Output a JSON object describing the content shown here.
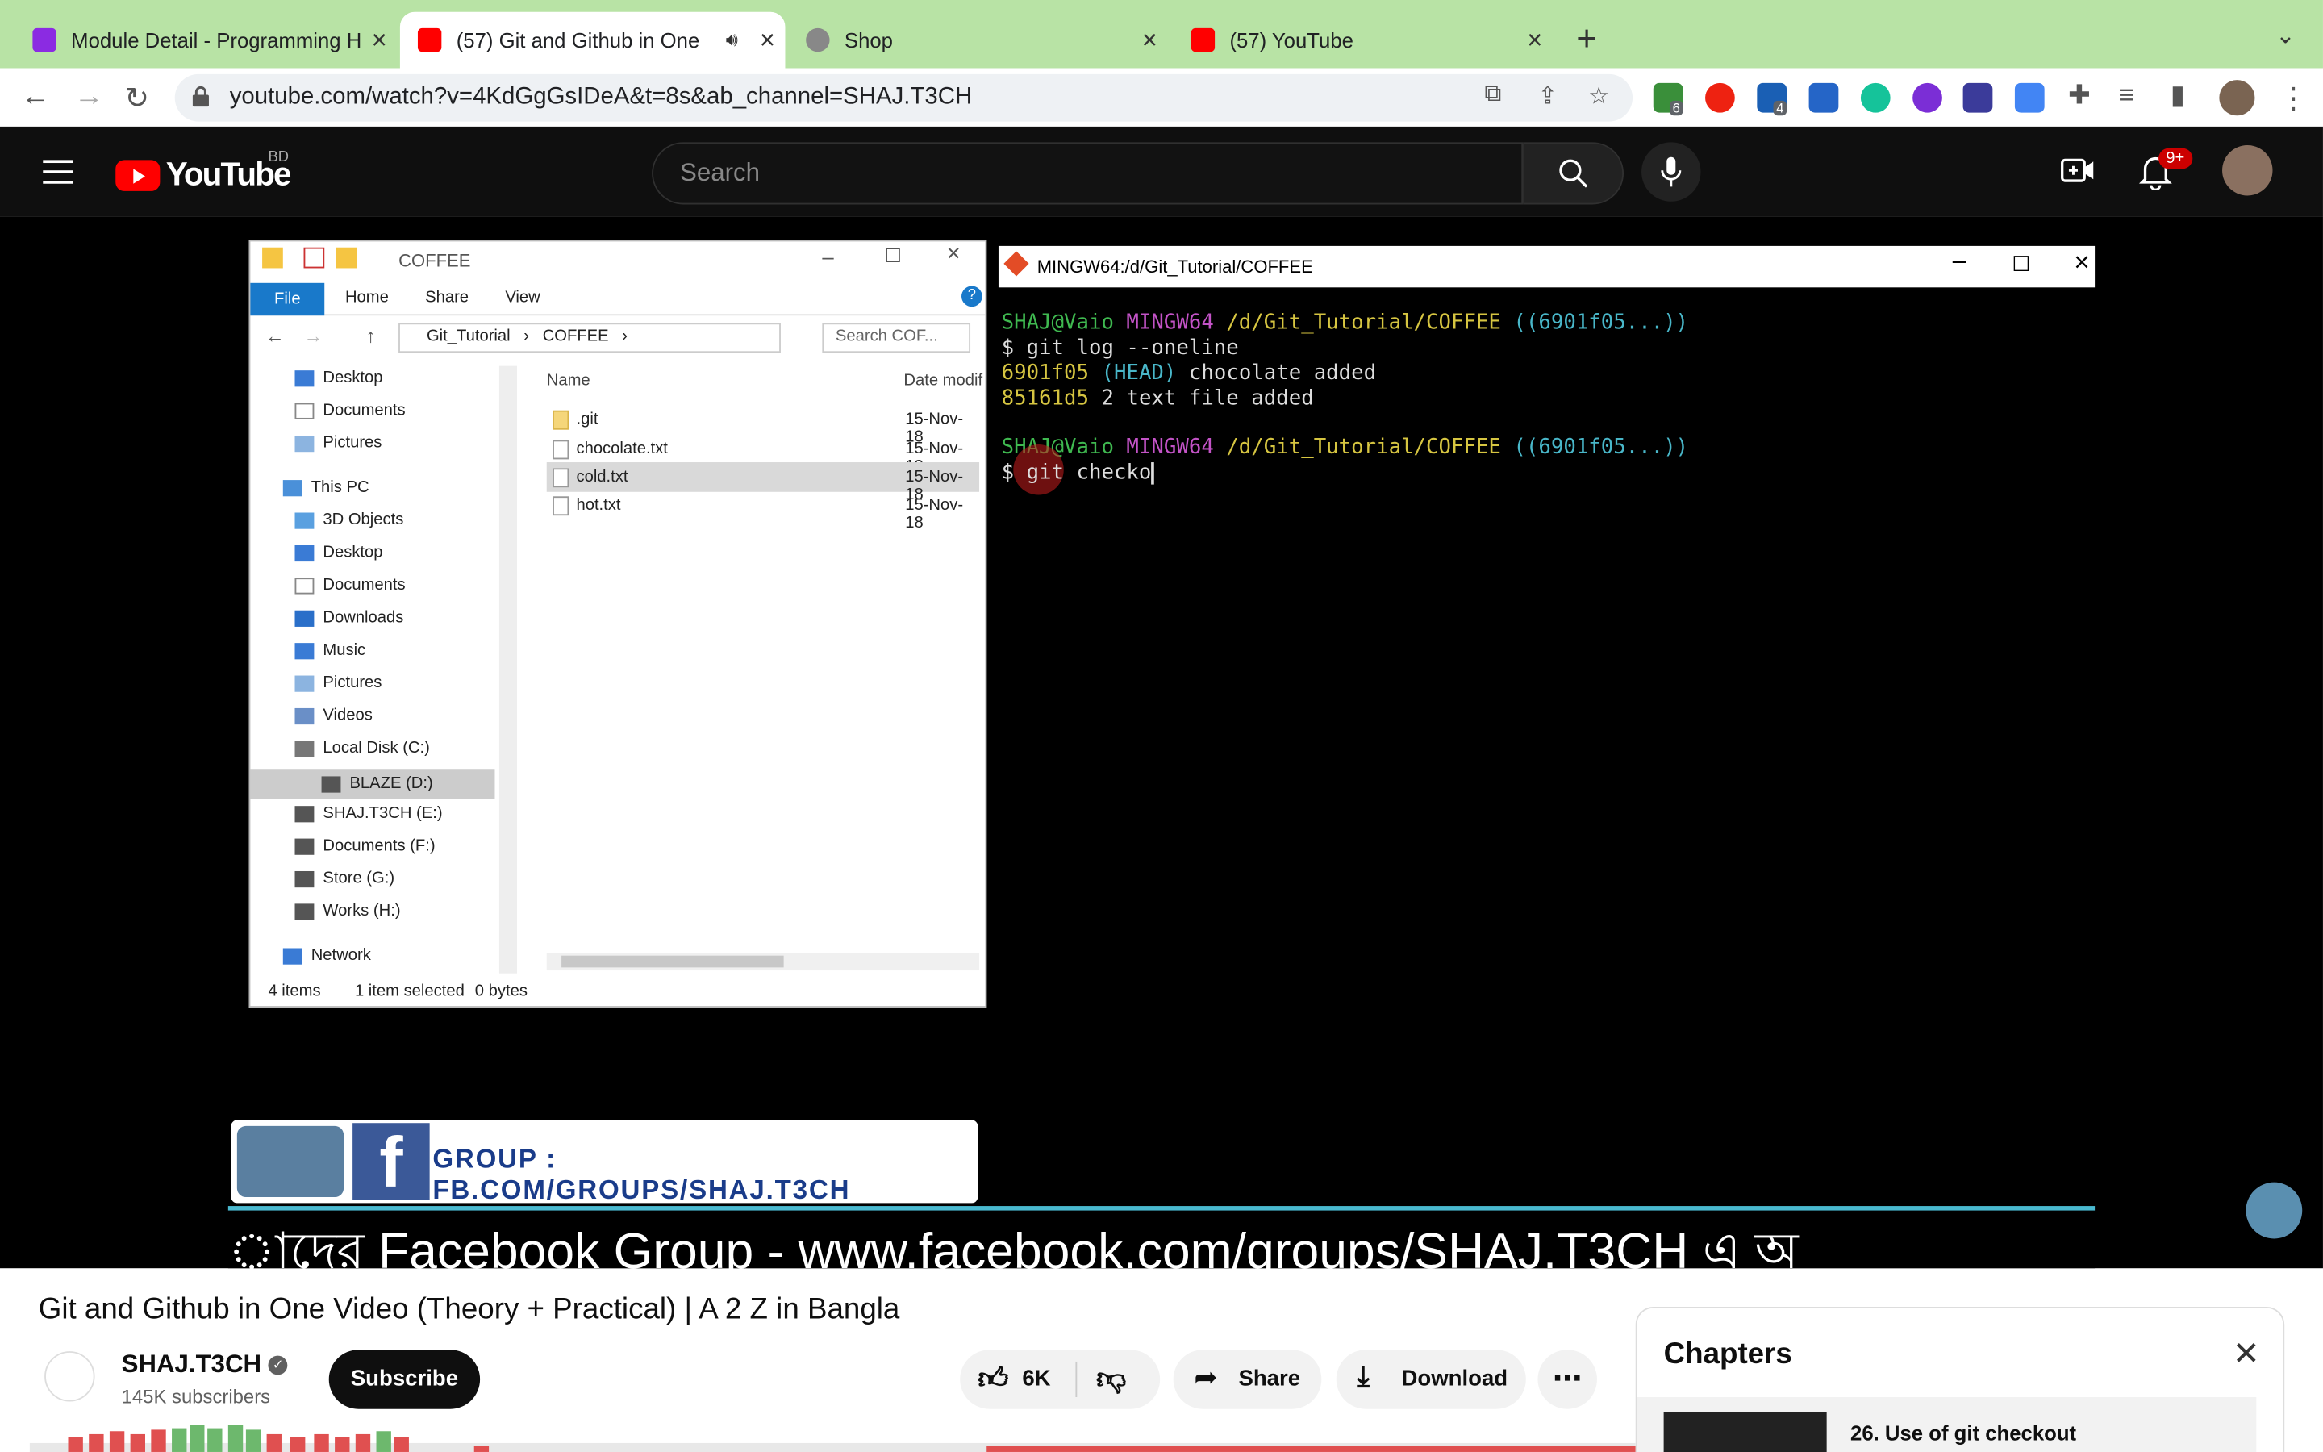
{
  "browser": {
    "tabs": [
      {
        "title": "Module Detail - Programming H",
        "active": false
      },
      {
        "title": "(57) Git and Github in One",
        "active": true
      },
      {
        "title": "Shop",
        "active": false
      },
      {
        "title": "(57) YouTube",
        "active": false
      }
    ],
    "url": "youtube.com/watch?v=4KdGgGsIDeA&t=8s&ab_channel=SHAJ.T3CH",
    "extension_badges": [
      "6",
      "4"
    ]
  },
  "youtube": {
    "country": "BD",
    "search_placeholder": "Search",
    "notification_count": "9+"
  },
  "explorer": {
    "title": "COFFEE",
    "ribbon": [
      "File",
      "Home",
      "Share",
      "View"
    ],
    "path": [
      "Git_Tutorial",
      "COFFEE"
    ],
    "search_placeholder": "Search COF...",
    "col_name": "Name",
    "col_date": "Date modif",
    "nav": [
      {
        "label": "Desktop"
      },
      {
        "label": "Documents"
      },
      {
        "label": "Pictures"
      },
      {
        "label": "This PC"
      },
      {
        "label": "3D Objects"
      },
      {
        "label": "Desktop"
      },
      {
        "label": "Documents"
      },
      {
        "label": "Downloads"
      },
      {
        "label": "Music"
      },
      {
        "label": "Pictures"
      },
      {
        "label": "Videos"
      },
      {
        "label": "Local Disk (C:)"
      },
      {
        "label": "BLAZE (D:)",
        "selected": true
      },
      {
        "label": "SHAJ.T3CH (E:)"
      },
      {
        "label": "Documents (F:)"
      },
      {
        "label": "Store (G:)"
      },
      {
        "label": "Works (H:)"
      },
      {
        "label": "Network"
      }
    ],
    "files": [
      {
        "name": ".git",
        "date": "15-Nov-18"
      },
      {
        "name": "chocolate.txt",
        "date": "15-Nov-18"
      },
      {
        "name": "cold.txt",
        "date": "15-Nov-18",
        "selected": true
      },
      {
        "name": "hot.txt",
        "date": "15-Nov-18"
      }
    ],
    "status_items": "4 items",
    "status_selected": "1 item selected",
    "status_size": "0 bytes"
  },
  "terminal": {
    "title": "MINGW64:/d/Git_Tutorial/COFFEE",
    "lines": [
      {
        "user": "SHAJ@Vaio",
        "env": "MINGW64",
        "path": "/d/Git_Tutorial/COFFEE",
        "branch": "((6901f05...))"
      },
      {
        "text": "$ git log --oneline"
      },
      {
        "hash": "6901f05",
        "ref": "(HEAD)",
        "msg": "chocolate added"
      },
      {
        "hash": "85161d5",
        "msg": "2 text file added"
      },
      {
        "user": "SHAJ@Vaio",
        "env": "MINGW64",
        "path": "/d/Git_Tutorial/COFFEE",
        "branch": "((6901f05...))"
      },
      {
        "text": "$ git checko"
      }
    ],
    "colors": {
      "user": "#3fb950",
      "env": "#c353c7",
      "path": "#d6c541",
      "branch": "#49b7c9",
      "text": "#dddddd",
      "hash": "#d6c541"
    }
  },
  "video_overlay": {
    "group_label": "GROUP : FB.COM/GROUPS/SHAJ.T3CH",
    "ticker": "াদের Facebook Group - www.facebook.com/groups/SHAJ.T3CH এ অ"
  },
  "video": {
    "title": "Git and Github in One Video (Theory + Practical) | A 2 Z in Bangla",
    "channel": "SHAJ.T3CH",
    "subscribers": "145K subscribers",
    "subscribe_label": "Subscribe",
    "likes": "6K",
    "share_label": "Share",
    "download_label": "Download"
  },
  "chapters": {
    "heading": "Chapters",
    "current": "26. Use of git checkout"
  }
}
